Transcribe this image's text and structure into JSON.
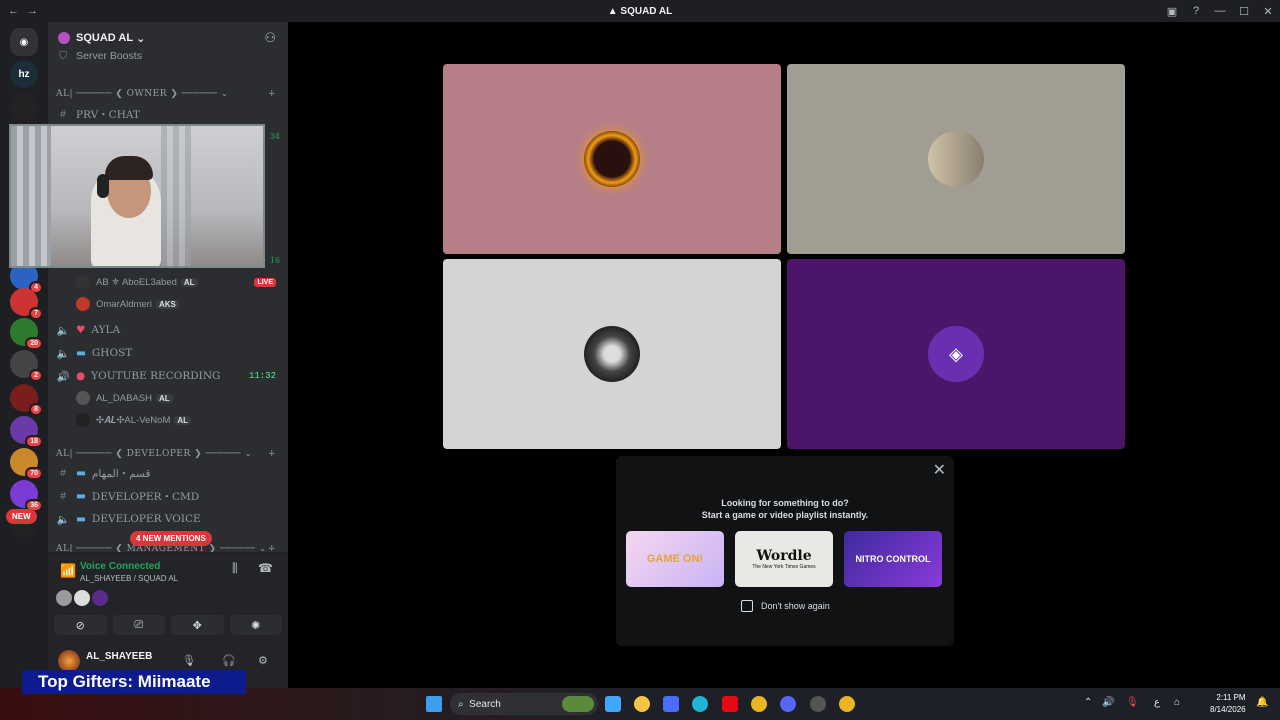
{
  "window": {
    "title": "SQUAD AL"
  },
  "titlebar": {
    "back": "←",
    "forward": "→"
  },
  "server": {
    "name": "SQUAD AL",
    "boosts": "Server Boosts"
  },
  "rail_badges": [
    "4",
    "7",
    "20",
    "2",
    "8",
    "18",
    "70",
    "36",
    "NEW"
  ],
  "sidebar": {
    "cat_owner": "AL| ────── ❮ OWNER ❯ ────── ⌄",
    "prv_chat": "PRV・CHAT",
    "count_top": "34",
    "count_mid": "16",
    "users_top": [
      {
        "name": "AB ⚜ AboEL3abed",
        "tag": "AL",
        "live": "LIVE"
      },
      {
        "name": "OmarAldmeri",
        "tag": "AKS"
      }
    ],
    "ch_ayla": "AYLA",
    "ch_ghost": "GHOST",
    "ch_youtube": "YOUTUBE RECORDING",
    "youtube_time": "11:32",
    "users_yt": [
      {
        "name": "AL_DABASH",
        "tag": "AL"
      },
      {
        "name": "✣𝑨𝑳✣AL-VeNoM",
        "tag": "AL"
      }
    ],
    "cat_developer": "AL| ────── ❮ DEVELOPER ❯ ────── ⌄",
    "ch_tasks": "قسم・المهام",
    "ch_dev_cmd": "DEVELOPER・CMD",
    "ch_dev_voice": "DEVELOPER VOICE",
    "cat_management": "AL| ────── ❮ MANAGEMENT ❯ ────── ⌄",
    "new_badge": "NEW",
    "mentions": "4 NEW MENTIONS"
  },
  "voice": {
    "status": "Voice Connected",
    "channel": "AL_SHAYEEB / SQUAD AL"
  },
  "user": {
    "name": "AL_SHAYEEB"
  },
  "popup": {
    "line1": "Looking for something to do?",
    "line2": "Start a game or video playlist instantly.",
    "activities": [
      "GAME ON!",
      "Wordle",
      "NITRO CONTROL"
    ],
    "wordle_sub": "The New York Times Games",
    "dont_show": "Don't show again"
  },
  "overlay": {
    "gifters": "Top Gifters: Miimaate"
  },
  "taskbar": {
    "search": "Search",
    "time": "2:11 PM",
    "date": "8/14/2026",
    "lang": "ع"
  },
  "colors": {
    "tile1": "#b67f88",
    "tile2": "#a19d92",
    "tile3": "#d4d4d4",
    "tile4": "#4b1669",
    "accent_green": "#23a559",
    "danger": "#da373c"
  }
}
